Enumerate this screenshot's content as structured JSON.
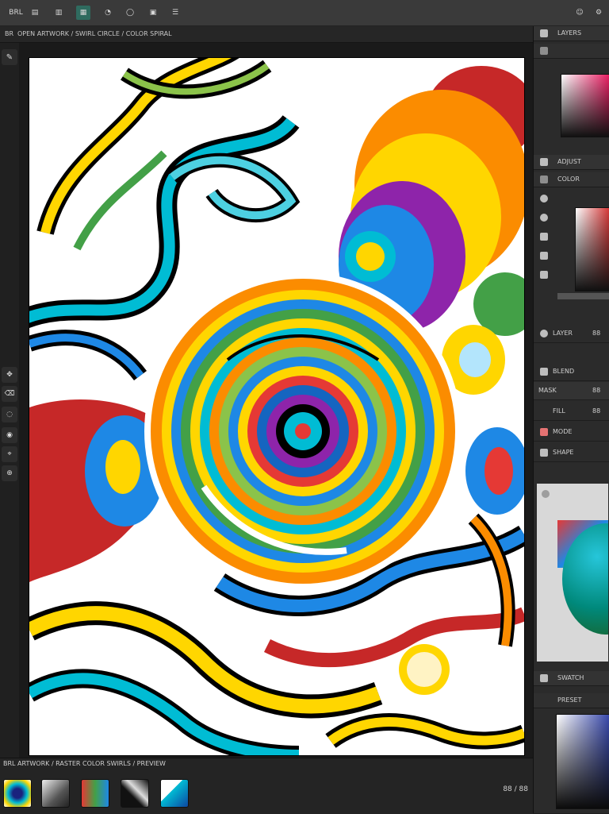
{
  "app": {
    "top_tools": [
      {
        "name": "brush-icon",
        "label": "BRL"
      },
      {
        "name": "stack-icon",
        "label": "▤"
      },
      {
        "name": "image-icon",
        "label": "▥"
      },
      {
        "name": "frame-icon",
        "label": "▦"
      },
      {
        "name": "clock-icon",
        "label": "◔"
      },
      {
        "name": "circle-icon",
        "label": "◯"
      },
      {
        "name": "box-icon",
        "label": "▣"
      },
      {
        "name": "menu-icon",
        "label": "☰"
      }
    ],
    "document_title": "OPEN  ARTWORK / SWIRL CIRCLE  / COLOR SPIRAL",
    "document_prefix": "BR",
    "bottom_label": "BRL  ARTWORK / RASTER COLOR SWIRLS / PREVIEW",
    "zoom_label": "88 / 88",
    "right_panel": {
      "layers_title": "LAYERS",
      "adjust_title": "ADJUST",
      "color_title": "COLOR",
      "rows": [
        {
          "label": "LAYER",
          "value": "88"
        },
        {
          "label": "BLEND",
          "value": ""
        },
        {
          "label": "MASK",
          "value": "88"
        },
        {
          "label": "FILL",
          "value": "88"
        },
        {
          "label": "MODE",
          "value": ""
        },
        {
          "label": "SHAPE",
          "value": ""
        }
      ],
      "bottom_title": "SWATCH",
      "bottom_sub": "PRESET"
    },
    "colors": {
      "accent_red": "#e53935",
      "accent_blue": "#1e88e5",
      "accent_yellow": "#ffd600",
      "accent_green": "#43a047",
      "accent_purple": "#8e24aa",
      "accent_orange": "#fb8c00"
    }
  }
}
